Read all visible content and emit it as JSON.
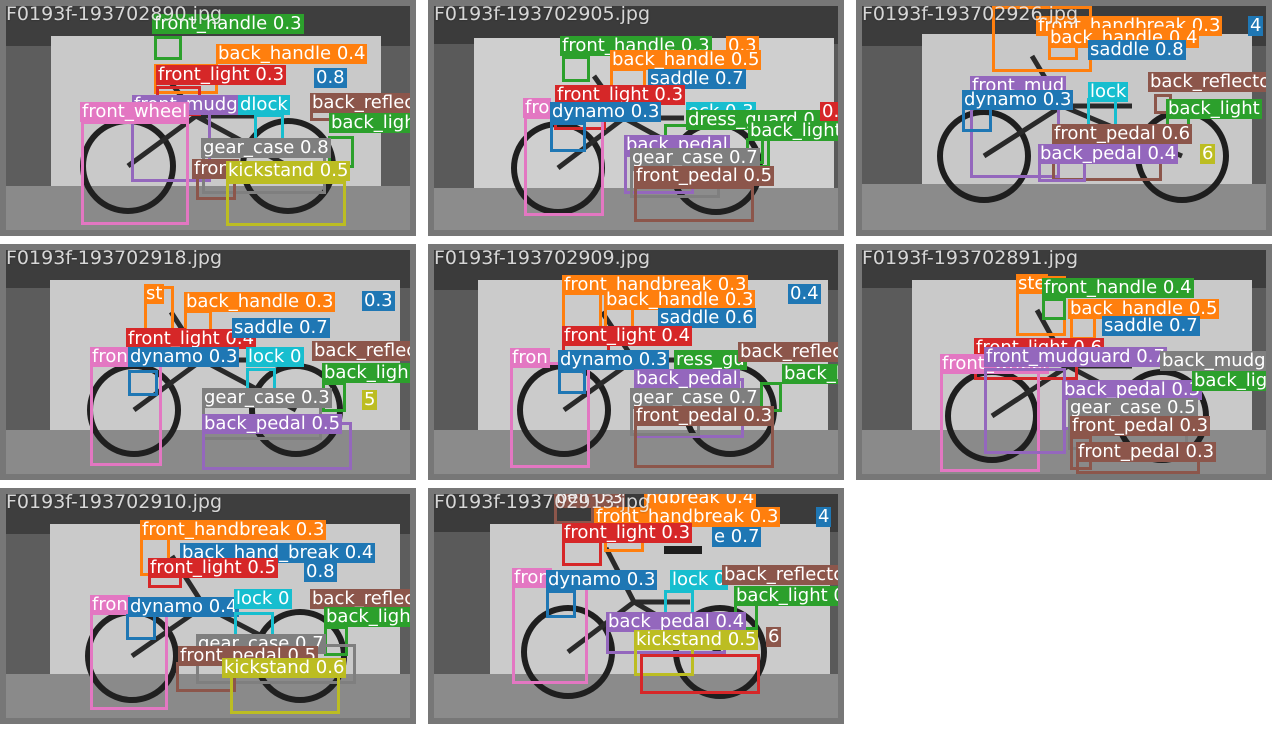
{
  "class_colors": {
    "front_handle": "#2ca02c",
    "back_handle": "#ff7f0e",
    "front_handbreak": "#ff7f0e",
    "back_hand_break": "#1f77b4",
    "front_light": "#d62728",
    "saddle": "#1f77b4",
    "front_mudguard": "#9467bd",
    "front_wheel": "#e377c2",
    "lock": "#17becf",
    "back_reflector": "#8c564b",
    "back_light": "#2ca02c",
    "gear_case": "#7f7f7f",
    "kickstand": "#bcbd22",
    "dynamo": "#1f77b4",
    "dress_guard": "#2ca02c",
    "back_pedal": "#9467bd",
    "front_pedal": "#8c564b",
    "bell": "#8c564b",
    "steer": "#ff7f0e",
    "back_mudguard": "#7f7f7f",
    "back_wheel": "#e377c2"
  },
  "tiles": [
    {
      "filename": "F0193f-193702890.jpg",
      "detections": [
        {
          "label": "front_handle 0.3",
          "cls": "front_handle"
        },
        {
          "label": "back_handle 0.4",
          "cls": "back_handle"
        },
        {
          "label": "front_light 0.3",
          "cls": "front_light"
        },
        {
          "label": "0.8",
          "cls": "saddle"
        },
        {
          "label": "front_mudguard",
          "cls": "front_mudguard"
        },
        {
          "label": "front_wheel",
          "cls": "front_wheel"
        },
        {
          "label": "dlock",
          "cls": "lock"
        },
        {
          "label": "back_reflec",
          "cls": "back_reflector"
        },
        {
          "label": "back_ligh",
          "cls": "back_light"
        },
        {
          "label": "gear_case 0.8",
          "cls": "gear_case"
        },
        {
          "label": "front",
          "cls": "front_pedal"
        },
        {
          "label": "kickstand 0.5",
          "cls": "kickstand"
        }
      ]
    },
    {
      "filename": "F0193f-193702905.jpg",
      "detections": [
        {
          "label": "front_handle 0.3",
          "cls": "front_handle"
        },
        {
          "label": "0.3",
          "cls": "back_handle"
        },
        {
          "label": "back_handle 0.5",
          "cls": "back_handle"
        },
        {
          "label": "saddle 0.7",
          "cls": "saddle"
        },
        {
          "label": "front_light 0.3",
          "cls": "front_light"
        },
        {
          "label": "fro",
          "cls": "front_wheel"
        },
        {
          "label": "dynamo 0.3",
          "cls": "dynamo"
        },
        {
          "label": "ock 0.3",
          "cls": "lock"
        },
        {
          "label": "dress_guard 0.6",
          "cls": "dress_guard"
        },
        {
          "label": "0.8",
          "cls": "front_light"
        },
        {
          "label": "back_light",
          "cls": "back_light"
        },
        {
          "label": "back_pedal",
          "cls": "back_pedal"
        },
        {
          "label": "gear_case 0.7",
          "cls": "gear_case"
        },
        {
          "label": "front_pedal 0.5",
          "cls": "front_pedal"
        }
      ]
    },
    {
      "filename": "F0193f-193702926.jpg",
      "detections": [
        {
          "label": "front_handbreak 0.3",
          "cls": "front_handbreak"
        },
        {
          "label": "4",
          "cls": "back_hand_break"
        },
        {
          "label": "back_handle 0.4",
          "cls": "back_handle"
        },
        {
          "label": "saddle 0.8",
          "cls": "saddle"
        },
        {
          "label": "front_mud",
          "cls": "front_mudguard"
        },
        {
          "label": "back_reflecto",
          "cls": "back_reflector"
        },
        {
          "label": "dynamo 0.3",
          "cls": "dynamo"
        },
        {
          "label": "lock",
          "cls": "lock"
        },
        {
          "label": "back_light",
          "cls": "back_light"
        },
        {
          "label": "front_pedal 0.6",
          "cls": "front_pedal"
        },
        {
          "label": "back_pedal 0.4",
          "cls": "back_pedal"
        },
        {
          "label": "6",
          "cls": "kickstand"
        }
      ]
    },
    {
      "filename": "F0193f-193702918.jpg",
      "detections": [
        {
          "label": "st",
          "cls": "steer"
        },
        {
          "label": "back_handle 0.3",
          "cls": "back_handle"
        },
        {
          "label": "0.3",
          "cls": "back_hand_break"
        },
        {
          "label": "front_light 0.4",
          "cls": "front_light"
        },
        {
          "label": "saddle 0.7",
          "cls": "saddle"
        },
        {
          "label": "fron",
          "cls": "front_wheel"
        },
        {
          "label": "dynamo 0.3",
          "cls": "dynamo"
        },
        {
          "label": "lock 0",
          "cls": "lock"
        },
        {
          "label": "back_reflec",
          "cls": "back_reflector"
        },
        {
          "label": "back_ligh",
          "cls": "back_light"
        },
        {
          "label": "gear_case 0.3",
          "cls": "gear_case"
        },
        {
          "label": "5",
          "cls": "kickstand"
        },
        {
          "label": "back_pedal 0.5",
          "cls": "back_pedal"
        }
      ]
    },
    {
      "filename": "F0193f-193702909.jpg",
      "detections": [
        {
          "label": "front_handbreak 0.3",
          "cls": "front_handbreak"
        },
        {
          "label": "0.4",
          "cls": "back_hand_break"
        },
        {
          "label": "back_handle 0.3",
          "cls": "back_handle"
        },
        {
          "label": "saddle 0.6",
          "cls": "saddle"
        },
        {
          "label": "front_light 0.4",
          "cls": "front_light"
        },
        {
          "label": "fron",
          "cls": "front_wheel"
        },
        {
          "label": "dynamo 0.3",
          "cls": "dynamo"
        },
        {
          "label": "ress_gu",
          "cls": "dress_guard"
        },
        {
          "label": "back_reflec",
          "cls": "back_reflector"
        },
        {
          "label": "back_pedal",
          "cls": "back_pedal"
        },
        {
          "label": "back_ligh",
          "cls": "back_light"
        },
        {
          "label": "gear_case 0.7",
          "cls": "gear_case"
        },
        {
          "label": "front_pedal 0.3",
          "cls": "front_pedal"
        }
      ]
    },
    {
      "filename": "F0193f-193702891.jpg",
      "detections": [
        {
          "label": "ste",
          "cls": "steer"
        },
        {
          "label": "front_handle 0.4",
          "cls": "front_handle"
        },
        {
          "label": "back_handle 0.5",
          "cls": "back_handle"
        },
        {
          "label": "saddle 0.7",
          "cls": "saddle"
        },
        {
          "label": "front_light 0.6",
          "cls": "front_light"
        },
        {
          "label": "front_wheel",
          "cls": "front_wheel"
        },
        {
          "label": "front_mudguard 0.7",
          "cls": "front_mudguard"
        },
        {
          "label": "back_mudguard 0.",
          "cls": "back_mudguard"
        },
        {
          "label": "back_pedal 0.3",
          "cls": "back_pedal"
        },
        {
          "label": "back_ligh",
          "cls": "back_light"
        },
        {
          "label": "gear_case 0.5",
          "cls": "gear_case"
        },
        {
          "label": "front_pedal 0.3",
          "cls": "front_pedal"
        },
        {
          "label": "front_pedal 0.3",
          "cls": "front_pedal"
        }
      ]
    },
    {
      "filename": "F0193f-193702910.jpg",
      "detections": [
        {
          "label": "front_handbreak 0.3",
          "cls": "front_handbreak"
        },
        {
          "label": "back_hand_break 0.4",
          "cls": "back_hand_break"
        },
        {
          "label": "front_light 0.5",
          "cls": "front_light"
        },
        {
          "label": "0.8",
          "cls": "saddle"
        },
        {
          "label": "fron",
          "cls": "front_wheel"
        },
        {
          "label": "dynamo 0.4",
          "cls": "dynamo"
        },
        {
          "label": "lock 0",
          "cls": "lock"
        },
        {
          "label": "back_reflec",
          "cls": "back_reflector"
        },
        {
          "label": "back_light",
          "cls": "back_light"
        },
        {
          "label": "gear_case 0.7",
          "cls": "gear_case"
        },
        {
          "label": "front_pedal 0.5",
          "cls": "front_pedal"
        },
        {
          "label": "kickstand 0.6",
          "cls": "kickstand"
        }
      ]
    },
    {
      "filename": "F0193f-193702913.jpg",
      "detections": [
        {
          "label": "bell 0.3",
          "cls": "bell"
        },
        {
          "label": "ndbreak 0.4",
          "cls": "front_handbreak"
        },
        {
          "label": "front_handbreak 0.3",
          "cls": "front_handbreak"
        },
        {
          "label": "4",
          "cls": "back_hand_break"
        },
        {
          "label": "front_light 0.3",
          "cls": "front_light"
        },
        {
          "label": "e 0.7",
          "cls": "saddle"
        },
        {
          "label": "fron",
          "cls": "front_wheel"
        },
        {
          "label": "dynamo 0.3",
          "cls": "dynamo"
        },
        {
          "label": "lock 0",
          "cls": "lock"
        },
        {
          "label": "back_reflector 0.3",
          "cls": "back_reflector"
        },
        {
          "label": "back_light 0.4",
          "cls": "back_light"
        },
        {
          "label": "back_pedal 0.4",
          "cls": "back_pedal"
        },
        {
          "label": "6",
          "cls": "front_pedal"
        },
        {
          "label": "kickstand 0.5",
          "cls": "kickstand"
        }
      ]
    }
  ]
}
